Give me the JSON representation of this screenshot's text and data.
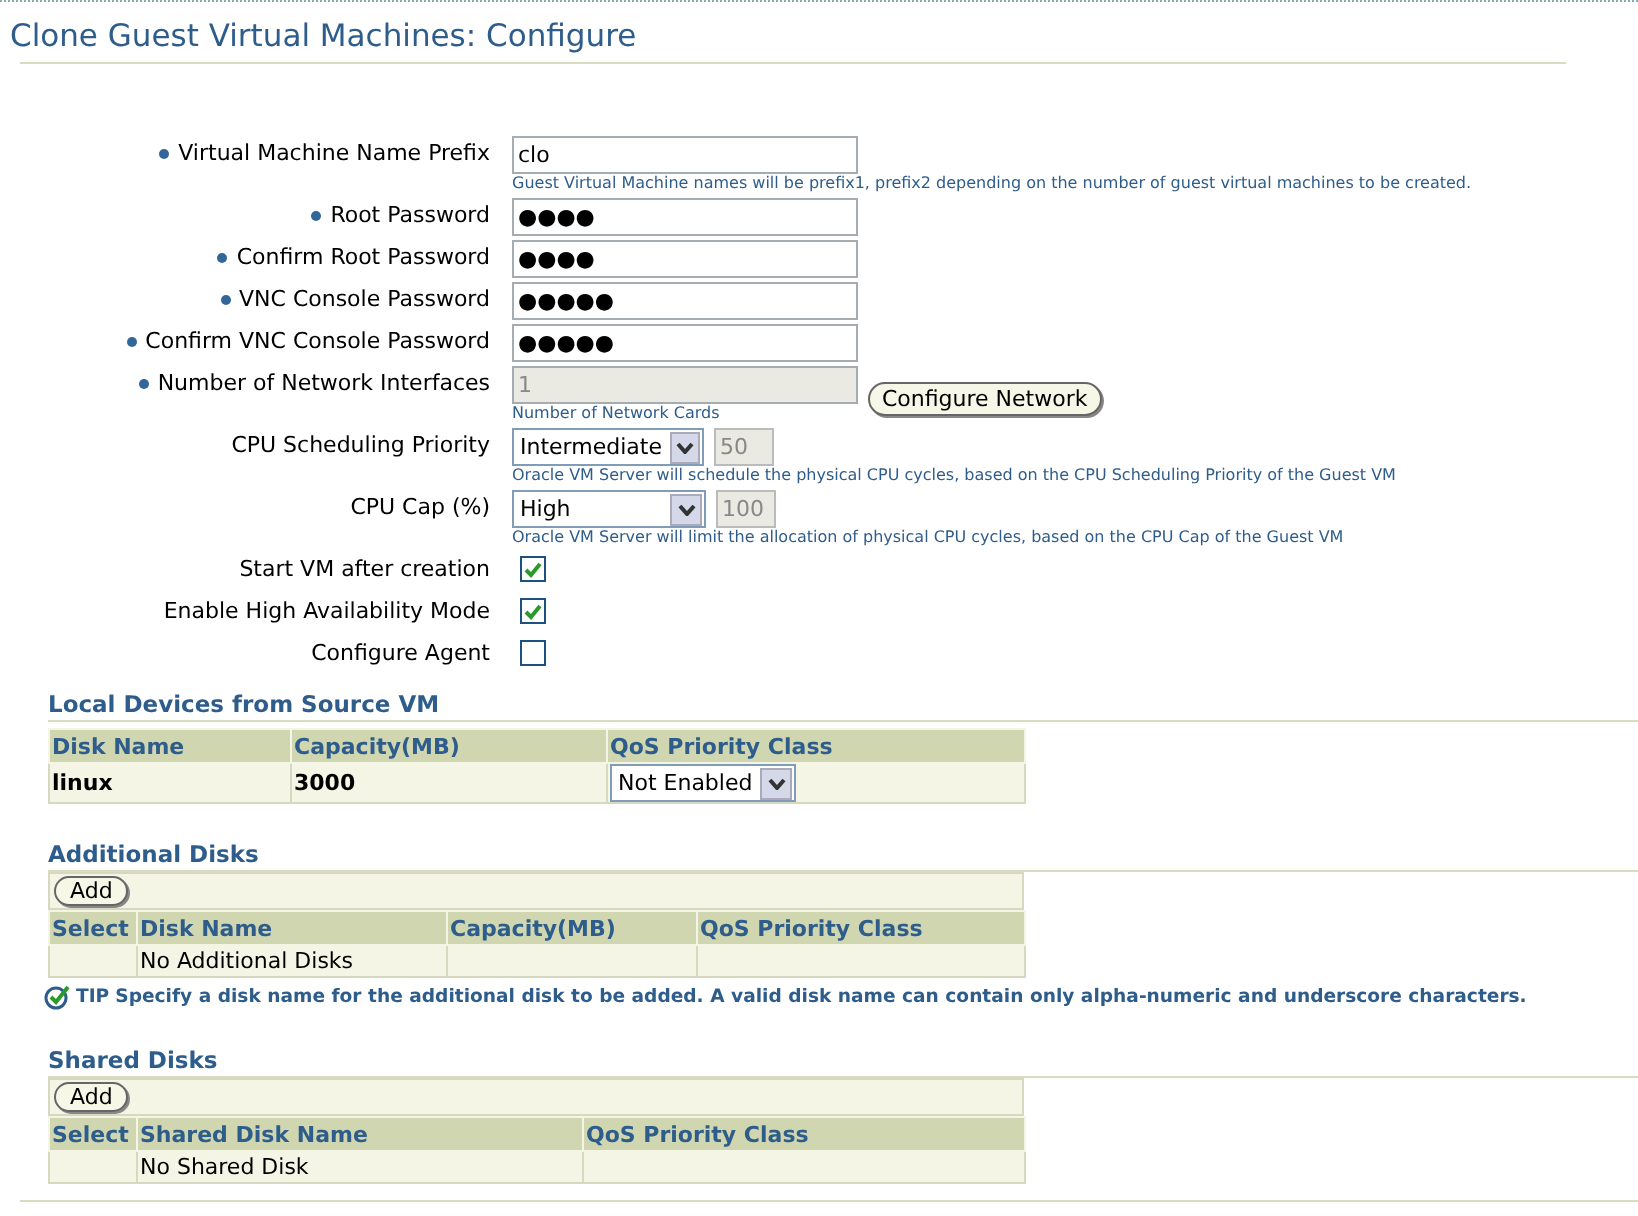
{
  "page": {
    "title": "Clone Guest Virtual Machines: Configure"
  },
  "form": [
    {
      "kind": "text",
      "label": "Virtual Machine Name Prefix",
      "required": true,
      "value": "clo",
      "hint": "Guest Virtual Machine names will be prefix1, prefix2 depending on the number of guest virtual machines to be created."
    },
    {
      "kind": "text",
      "label": "Root Password",
      "required": true,
      "value": "●●●●"
    },
    {
      "kind": "text",
      "label": "Confirm Root Password",
      "required": true,
      "value": "●●●●"
    },
    {
      "kind": "text",
      "label": "VNC Console Password",
      "required": true,
      "value": "●●●●●"
    },
    {
      "kind": "text",
      "label": "Confirm VNC Console Password",
      "required": true,
      "value": "●●●●●"
    },
    {
      "kind": "text",
      "label": "Number of Network Interfaces",
      "required": true,
      "value": "1",
      "disabled": true,
      "button": "Configure Network",
      "hint": "Number of Network Cards"
    },
    {
      "kind": "select",
      "label": "CPU Scheduling Priority",
      "required": false,
      "value": "Intermediate",
      "number": {
        "value": "50",
        "disabled": true
      },
      "hint": "Oracle VM Server will schedule the physical CPU cycles, based on the CPU Scheduling Priority of the Guest VM"
    },
    {
      "kind": "select",
      "label": "CPU Cap (%)",
      "required": false,
      "value": "High",
      "number": {
        "value": "100",
        "disabled": true
      },
      "hint": "Oracle VM Server will limit the allocation of physical CPU cycles, based on the CPU Cap of the Guest VM"
    },
    {
      "kind": "checkbox",
      "label": "Start VM after creation",
      "required": false,
      "checked": true
    },
    {
      "kind": "checkbox",
      "label": "Enable High Availability Mode",
      "required": false,
      "checked": true
    },
    {
      "kind": "checkbox",
      "label": "Configure Agent",
      "required": false,
      "checked": false
    }
  ],
  "local_devices": {
    "title": "Local Devices from Source VM",
    "columns": [
      "Disk Name",
      "Capacity(MB)",
      "QoS Priority Class"
    ],
    "rows": [
      {
        "disk_name": "linux",
        "capacity": "3000",
        "qos": "Not Enabled"
      }
    ]
  },
  "additional_disks": {
    "title": "Additional Disks",
    "button": "Add",
    "columns": [
      "Select",
      "Disk Name",
      "Capacity(MB)",
      "QoS Priority Class"
    ],
    "empty_message": "No Additional Disks"
  },
  "tip": {
    "label": "TIP",
    "text": "Specify a disk name for the additional disk to be added. A valid disk name can contain only alpha-numeric and underscore characters."
  },
  "shared_disks": {
    "title": "Shared Disks",
    "button": "Add",
    "columns": [
      "Select",
      "Shared Disk Name",
      "QoS Priority Class"
    ],
    "empty_message": "No Shared Disk"
  }
}
